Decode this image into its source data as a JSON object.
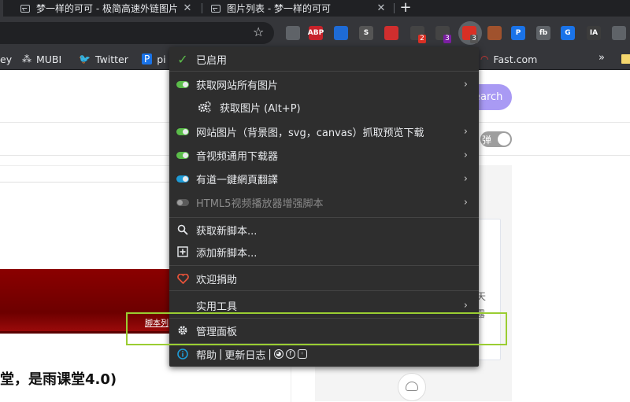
{
  "tabs": [
    {
      "title": "梦一样的可可 - 极简高速外链图片"
    },
    {
      "title": "图片列表 - 梦一样的可可"
    }
  ],
  "toolbar": {
    "extensions": [
      {
        "name": "shield-extension",
        "label": "",
        "color": "#5f6368"
      },
      {
        "name": "abp-extension",
        "label": "ABP",
        "color": "#c7222a"
      },
      {
        "name": "firefox-like-extension",
        "label": "",
        "color": "#1e6bd6"
      },
      {
        "name": "s-extension",
        "label": "S",
        "color": "#555"
      },
      {
        "name": "wand-extension",
        "label": "",
        "color": "#d02e2e"
      },
      {
        "name": "badge-extension-2",
        "label": "",
        "color": "#444",
        "badge": "2",
        "badge_color": "#d93025"
      },
      {
        "name": "badge-extension-3a",
        "label": "",
        "color": "#444",
        "badge": "3",
        "badge_color": "#7b1fa2"
      },
      {
        "name": "tampermonkey-extension",
        "label": "",
        "color": "#d93025",
        "badge": "3",
        "badge_color": "#555"
      },
      {
        "name": "cookie-extension",
        "label": "",
        "color": "#a0522d"
      },
      {
        "name": "p-extension",
        "label": "P",
        "color": "#1a73e8"
      },
      {
        "name": "fb-extension",
        "label": "fb",
        "color": "#5f6368"
      },
      {
        "name": "translate-extension",
        "label": "G",
        "color": "#1a73e8"
      },
      {
        "name": "ia-extension",
        "label": "IA",
        "color": "#3c3c3c"
      },
      {
        "name": "puzzle-extension",
        "label": "",
        "color": "#5f6368"
      }
    ]
  },
  "bookmarks": [
    {
      "label": "ey",
      "icon": ""
    },
    {
      "label": "MUBI",
      "icon": "⁂"
    },
    {
      "label": "Twitter",
      "icon": "🐦"
    },
    {
      "label": "pi",
      "icon": "P"
    },
    {
      "label": "Fast.com",
      "icon": "◠"
    }
  ],
  "page": {
    "search_label": "earch",
    "toggle_label": "弹",
    "banner_link": "脚本列",
    "article_title": "堂，是雨课堂4.0)",
    "right_char_1": "天",
    "right_char_2": "露"
  },
  "menu": {
    "enabled": "已启用",
    "items": [
      {
        "label": "获取网站所有图片",
        "switch": "on",
        "switch_color": "#5bbd4a",
        "submenu": true
      },
      {
        "label": "获取图片 (Alt+P)",
        "switch": "none",
        "submenu": false
      },
      {
        "label": "网站图片（背景图，svg，canvas）抓取预览下载",
        "switch": "on",
        "switch_color": "#5bbd4a",
        "submenu": true
      },
      {
        "label": "音视频通用下载器",
        "switch": "on",
        "switch_color": "#5bbd4a",
        "submenu": true
      },
      {
        "label": "有道一鍵網頁翻譯",
        "switch": "on",
        "switch_color": "#1e9bd6",
        "submenu": true
      },
      {
        "label": "HTML5视频播放器增强脚本",
        "switch": "off",
        "submenu": true
      }
    ],
    "get_new_scripts": "获取新脚本...",
    "add_new_script": "添加新脚本...",
    "donate": "欢迎捐助",
    "utilities": "实用工具",
    "dashboard": "管理面板",
    "help": "帮助",
    "sep": "|",
    "changelog": "更新日志",
    "highlight_color": "#9acd32"
  }
}
